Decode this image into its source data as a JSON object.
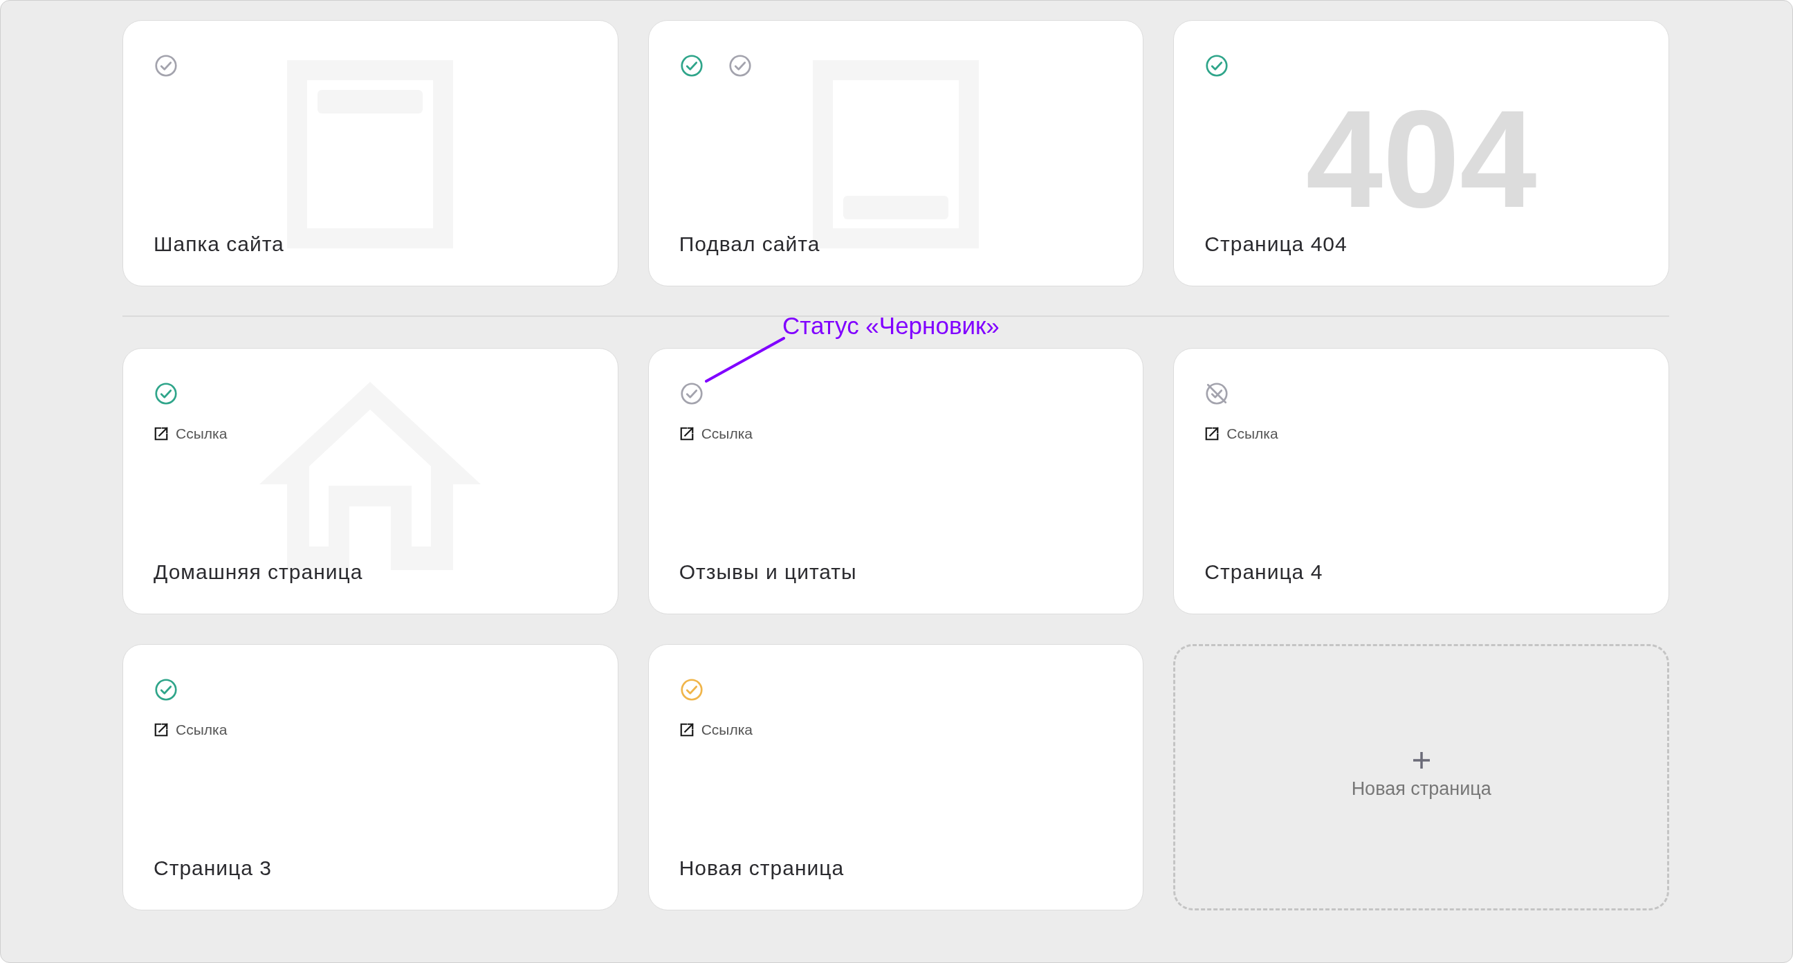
{
  "top_section": {
    "cards": [
      {
        "title": "Шапка сайта",
        "statuses": [
          {
            "kind": "draft"
          }
        ],
        "illustration": {
          "kind": "header"
        }
      },
      {
        "title": "Подвал сайта",
        "statuses": [
          {
            "kind": "published"
          },
          {
            "kind": "draft"
          }
        ],
        "illustration": {
          "kind": "footer"
        }
      },
      {
        "title": "Страница 404",
        "statuses": [
          {
            "kind": "published"
          }
        ],
        "illustration": {
          "kind": "error",
          "text": "404"
        }
      }
    ]
  },
  "main_section": {
    "cards": [
      {
        "title": "Домашняя страница",
        "statuses": [
          {
            "kind": "published"
          }
        ],
        "link": "Ссылка",
        "illustration": {
          "kind": "home"
        }
      },
      {
        "title": "Отзывы и цитаты",
        "statuses": [
          {
            "kind": "draft"
          }
        ],
        "link": "Ссылка"
      },
      {
        "title": "Страница 4",
        "statuses": [
          {
            "kind": "hidden"
          }
        ],
        "link": "Ссылка"
      },
      {
        "title": "Страница 3",
        "statuses": [
          {
            "kind": "published"
          }
        ],
        "link": "Ссылка"
      },
      {
        "title": "Новая страница",
        "statuses": [
          {
            "kind": "pending"
          }
        ],
        "link": "Ссылка"
      }
    ],
    "new_page_tile": {
      "label": "Новая страница"
    }
  },
  "annotation": {
    "text": "Статус «Черновик»"
  }
}
